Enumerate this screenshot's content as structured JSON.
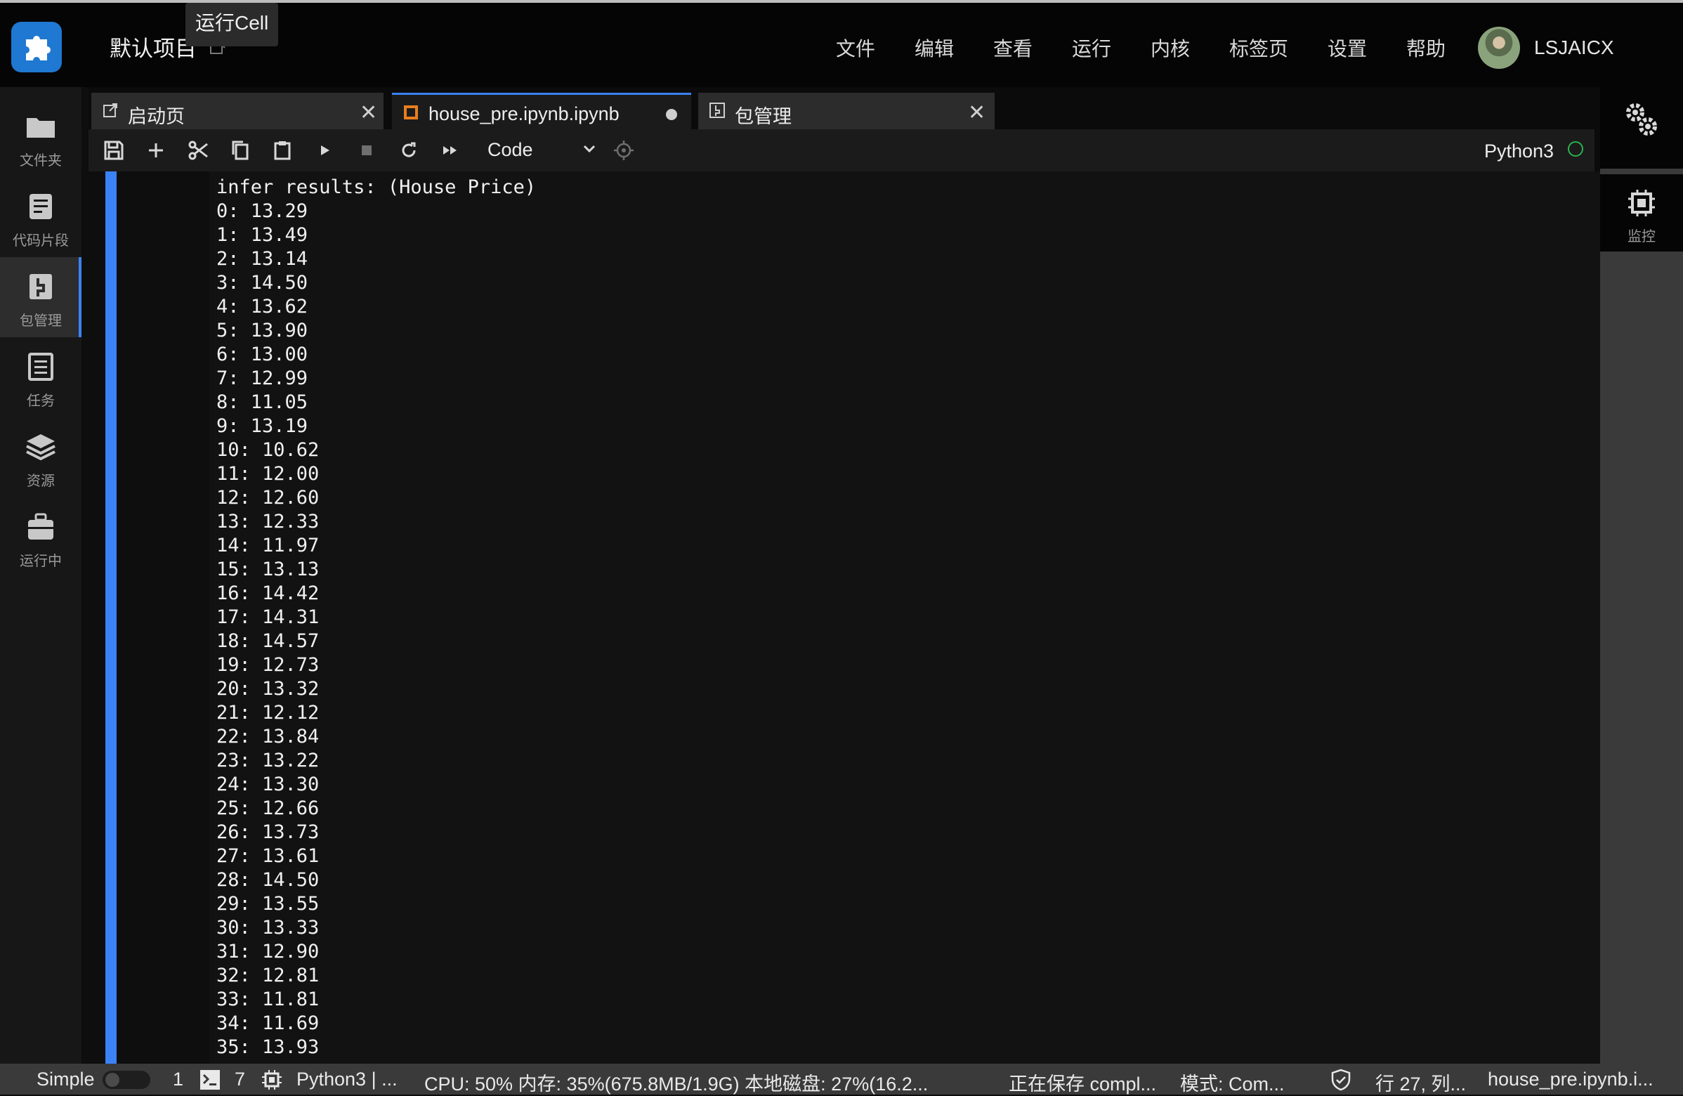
{
  "header": {
    "project_title": "默认项目",
    "tooltip": "运行Cell",
    "menu": [
      "文件",
      "编辑",
      "查看",
      "运行",
      "内核",
      "标签页",
      "设置",
      "帮助"
    ],
    "username": "LSJAICX"
  },
  "sidebar": {
    "items": [
      {
        "label": "文件夹",
        "icon": "folder-icon"
      },
      {
        "label": "代码片段",
        "icon": "code-snippet-icon"
      },
      {
        "label": "包管理",
        "icon": "package-icon",
        "active": true
      },
      {
        "label": "任务",
        "icon": "task-icon"
      },
      {
        "label": "资源",
        "icon": "layers-icon"
      },
      {
        "label": "运行中",
        "icon": "briefcase-icon"
      }
    ]
  },
  "tabs": [
    {
      "label": "启动页",
      "icon": "external-link-icon"
    },
    {
      "label": "house_pre.ipynb.ipynb",
      "icon": "notebook-icon",
      "active": true,
      "modified": true
    },
    {
      "label": "包管理",
      "icon": "package-icon"
    }
  ],
  "toolbar": {
    "cell_type": "Code",
    "kernel_name": "Python3"
  },
  "output": {
    "lines": [
      "infer results: (House Price)",
      "0: 13.29",
      "1: 13.49",
      "2: 13.14",
      "3: 14.50",
      "4: 13.62",
      "5: 13.90",
      "6: 13.00",
      "7: 12.99",
      "8: 11.05",
      "9: 13.19",
      "10: 10.62",
      "11: 12.00",
      "12: 12.60",
      "13: 12.33",
      "14: 11.97",
      "15: 13.13",
      "16: 14.42",
      "17: 14.31",
      "18: 14.57",
      "19: 12.73",
      "20: 13.32",
      "21: 12.12",
      "22: 13.84",
      "23: 13.22",
      "24: 13.30",
      "25: 12.66",
      "26: 13.73",
      "27: 13.61",
      "28: 14.50",
      "29: 13.55",
      "30: 13.33",
      "31: 12.90",
      "32: 12.81",
      "33: 11.81",
      "34: 11.69",
      "35: 13.93"
    ]
  },
  "rightbar": {
    "monitor_label": "监控"
  },
  "statusbar": {
    "mode_label": "Simple",
    "count_a": "1",
    "count_b": "7",
    "kernel": "Python3 | ...",
    "resources": "CPU:  50% 内存:  35%(675.8MB/1.9G) 本地磁盘:  27%(16.2...",
    "saving": "正在保存 compl...",
    "mode": "模式:  Com...",
    "position": "行 27, 列...",
    "file": "house_pre.ipynb.i..."
  }
}
